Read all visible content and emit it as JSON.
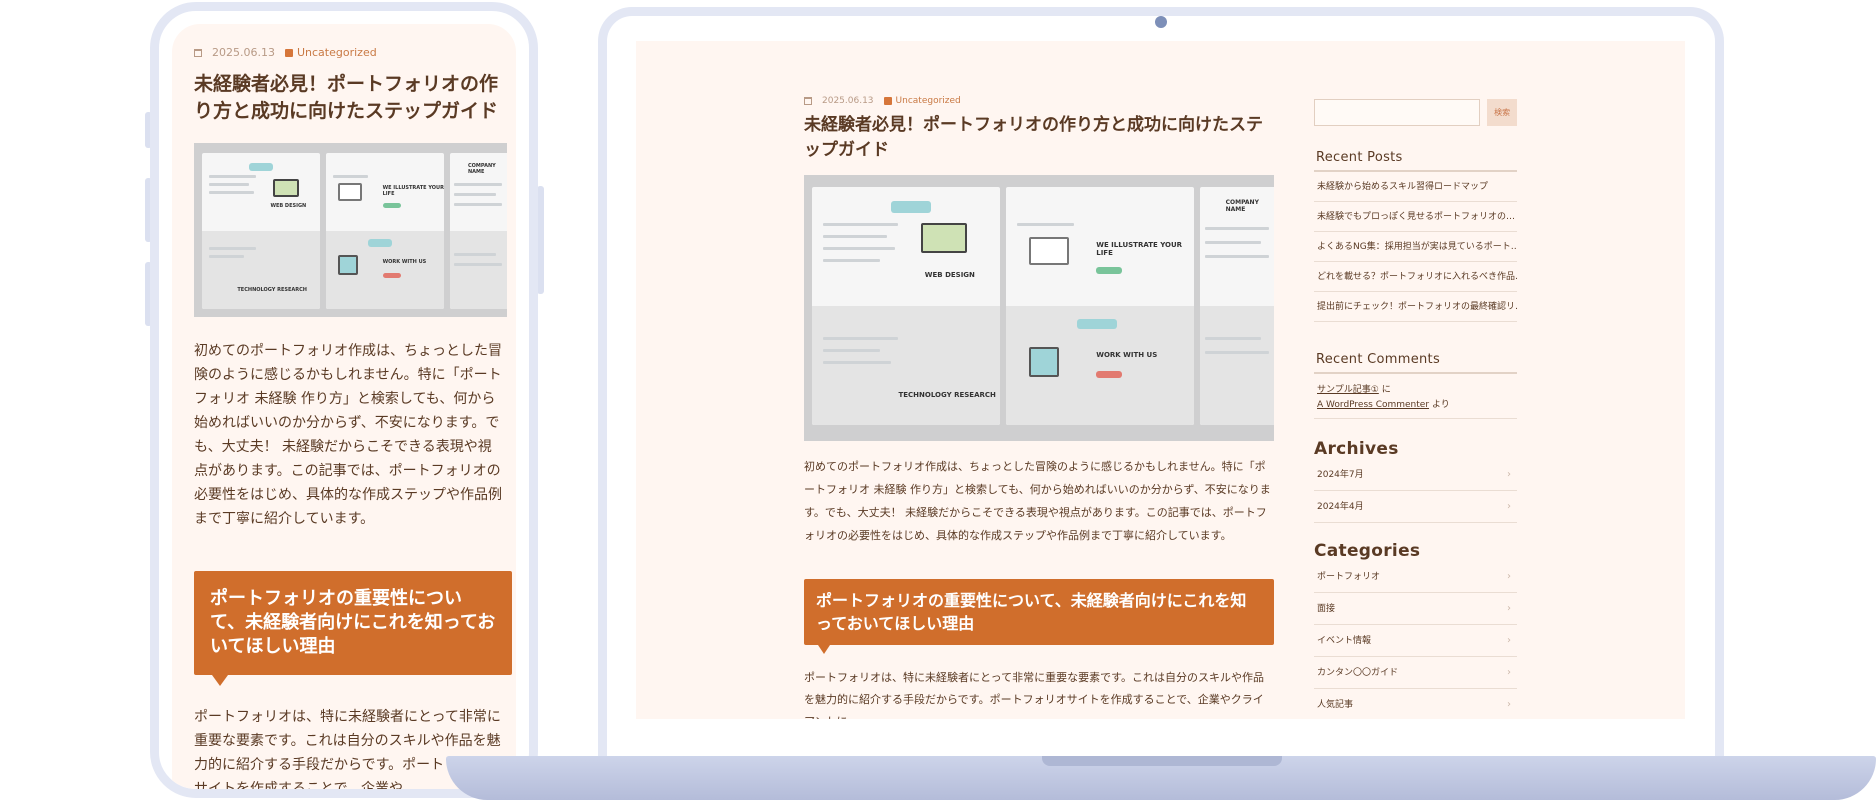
{
  "post": {
    "date": "2025.06.13",
    "category": "Uncategorized",
    "title": "未経験者必見！ポートフォリオの作り方と成功に向けたステップガイド",
    "intro": "初めてのポートフォリオ作成は、ちょっとした冒険のように感じるかもしれません。特に「ポートフォリオ 未経験 作り方」と検索しても、何から始めればいいのか分からず、不安になります。でも、大丈夫！ 未経験だからこそできる表現や視点があります。この記事では、ポートフォリオの必要性をはじめ、具体的な作成ステップや作品例まで丁寧に紹介しています。",
    "heading": "ポートフォリオの重要性について、未経験者向けにこれを知っておいてほしい理由",
    "paragraph2_phone": "ポートフォリオは、特に未経験者にとって非常に重要な要素です。これは自分のスキルや作品を魅力的に紹介する手段だからです。ポートフォリオサイトを作成することで、企業や",
    "paragraph2_laptop": "ポートフォリオは、特に未経験者にとって非常に重要な要素です。これは自分のスキルや作品を魅力的に紹介する手段だからです。ポートフォリオサイトを作成することで、企業やクライアントに"
  },
  "hero_image": {
    "labels": [
      "WEB DESIGN",
      "WE ILLUSTRATE YOUR LIFE",
      "TECHNOLOGY RESEARCH",
      "WORK WITH US",
      "COMPANY NAME"
    ]
  },
  "sidebar": {
    "search_placeholder": "",
    "search_button": "検索",
    "recent_posts_title": "Recent Posts",
    "recent_posts": [
      "未経験から始めるスキル習得ロードマップ",
      "未経験でもプロっぽく見せるポートフォリオの…",
      "よくあるNG集：採用担当が実は見ているポート…",
      "どれを載せる？ポートフォリオに入れるべき作品…",
      "提出前にチェック！ポートフォリオの最終確認リ…"
    ],
    "recent_comments_title": "Recent Comments",
    "comment": {
      "post_link": "サンプル記事①",
      "on_text": "に",
      "author_link": "A WordPress Commenter",
      "by_text": "より"
    },
    "archives_title": "Archives",
    "archives": [
      "2024年7月",
      "2024年4月"
    ],
    "categories_title": "Categories",
    "categories": [
      "ポートフォリオ",
      "面接",
      "イベント情報",
      "カンタン〇〇ガイド",
      "人気記事"
    ]
  },
  "colors": {
    "accent": "#d06e2c",
    "page_background": "#fff6f1",
    "device_frame": "#e3e7f4",
    "text": "#5a3a24"
  }
}
